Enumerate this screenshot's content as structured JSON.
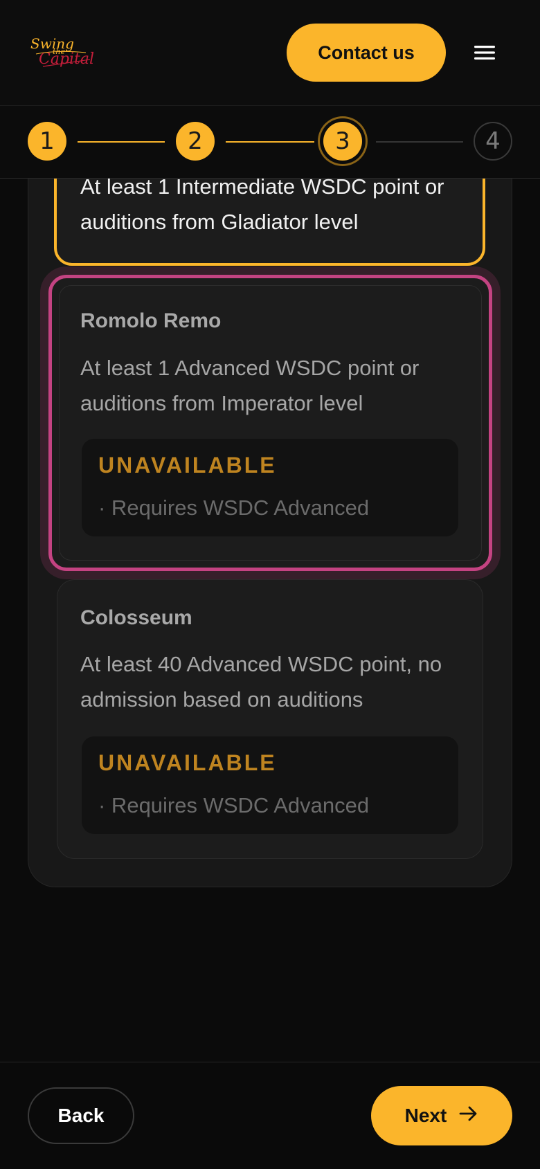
{
  "header": {
    "logo_text_line1": "Swing",
    "logo_text_line2": "the",
    "logo_text_line3": "Capital",
    "contact_label": "Contact us",
    "menu_icon": "hamburger-menu-icon"
  },
  "stepper": {
    "current_step": 3,
    "steps": [
      {
        "label": "1",
        "state": "done"
      },
      {
        "label": "2",
        "state": "done"
      },
      {
        "label": "3",
        "state": "active"
      },
      {
        "label": "4",
        "state": "todo"
      }
    ]
  },
  "levels": [
    {
      "title": "",
      "description": "At least 1 Intermediate WSDC point or auditions from Gladiator level",
      "state": "selected"
    },
    {
      "title": "Romolo Remo",
      "description": "At least 1 Advanced WSDC point or auditions from Imperator level",
      "status": "UNAVAILABLE",
      "note": "· Requires WSDC Advanced",
      "state": "highlighted"
    },
    {
      "title": "Colosseum",
      "description": "At least 40 Advanced WSDC point, no admission based on auditions",
      "status": "UNAVAILABLE",
      "note": "· Requires WSDC Advanced",
      "state": "unavailable"
    }
  ],
  "footer": {
    "back_label": "Back",
    "next_label": "Next",
    "next_icon": "arrow-right-icon"
  },
  "colors": {
    "accent": "#fbb52b",
    "highlight": "#c44382",
    "status_text": "#bf8420",
    "background": "#0b0b0b"
  }
}
